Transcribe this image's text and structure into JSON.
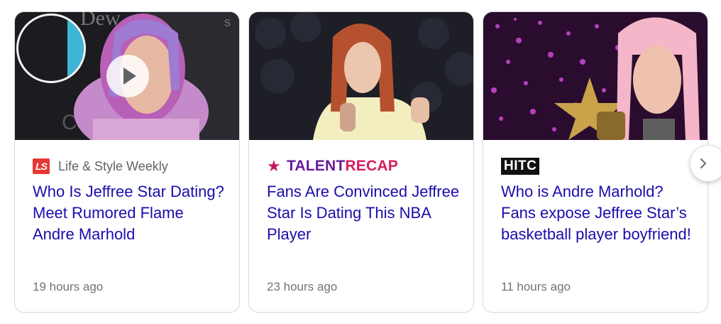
{
  "cards": [
    {
      "source": "Life & Style Weekly",
      "logo_text": "LS",
      "headline": "Who Is Jeffree Star Dating? Meet Rumored Flame Andre Marhold",
      "time": "19 hours ago",
      "has_video": true
    },
    {
      "source_part1": "TALENT",
      "source_part2": "RECAP",
      "headline": "Fans Are Convinced Jeffree Star Is Dating This NBA Player",
      "time": "23 hours ago"
    },
    {
      "source": "HITC",
      "headline": "Who is Andre Marhold? Fans expose Jeffree Star’s basketball player boyfriend!",
      "time": "11 hours ago"
    }
  ],
  "next_button": {
    "icon": "chevron-right-icon"
  },
  "colors": {
    "headline": "#1a0dab",
    "meta": "#70757a",
    "border": "#dadce0",
    "talentrecap_purple": "#6a1b9a",
    "talentrecap_pink": "#d81b60"
  }
}
